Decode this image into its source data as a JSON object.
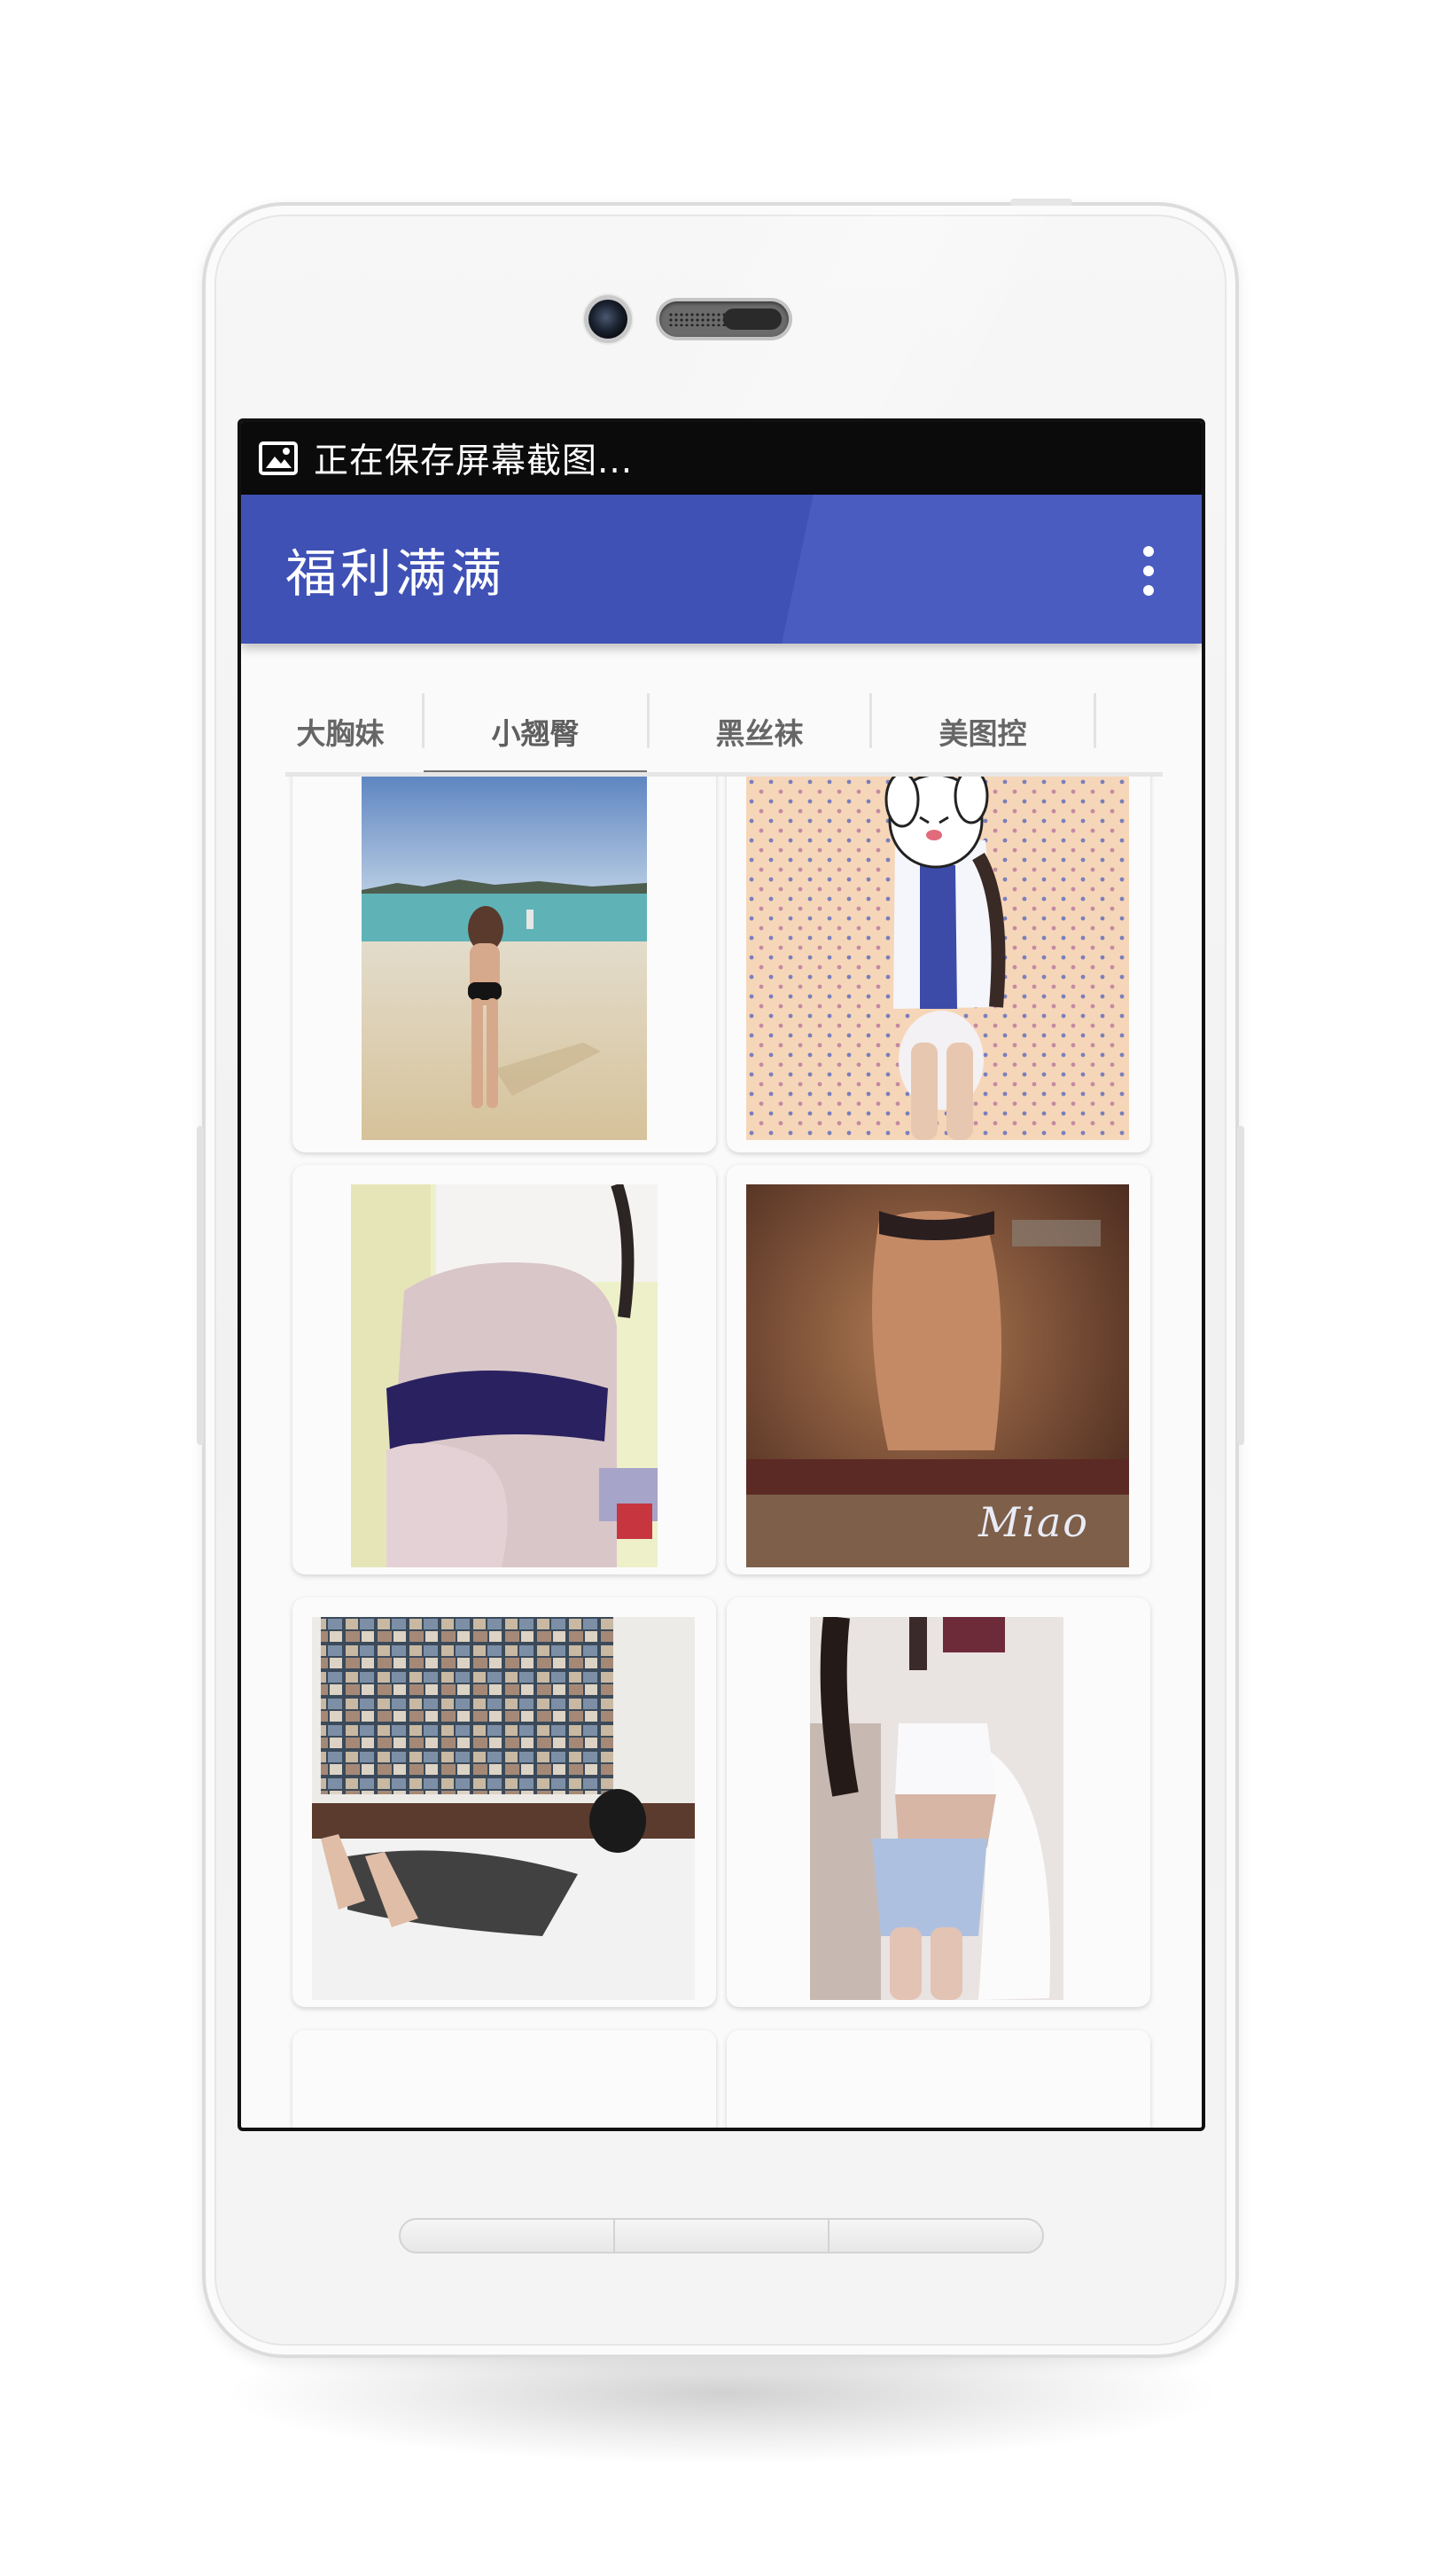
{
  "status_bar": {
    "notification_icon": "image-icon",
    "text": "正在保存屏幕截图..."
  },
  "app_bar": {
    "title": "福利满满",
    "menu_icon": "more-vert-icon",
    "color": "#3f51b5"
  },
  "tabs": {
    "items": [
      {
        "label": "大胸妹"
      },
      {
        "label": "小翘臀"
      },
      {
        "label": "黑丝袜"
      },
      {
        "label": "美图控"
      }
    ],
    "selected_index": 1
  },
  "grid": {
    "items": [
      {
        "kind": "photo",
        "overlay_text": ""
      },
      {
        "kind": "photo",
        "overlay_text": ""
      },
      {
        "kind": "photo",
        "overlay_text": ""
      },
      {
        "kind": "photo",
        "overlay_text": "Miao"
      },
      {
        "kind": "photo",
        "overlay_text": ""
      },
      {
        "kind": "photo",
        "overlay_text": ""
      }
    ]
  }
}
